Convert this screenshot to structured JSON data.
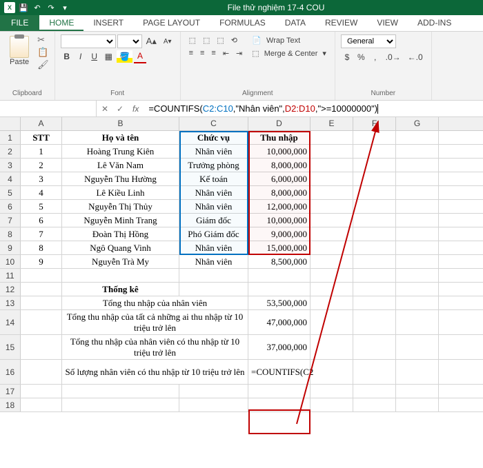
{
  "app": {
    "title": "File thử nghiệm 17-4 COU"
  },
  "tabs": {
    "file": "FILE",
    "home": "HOME",
    "insert": "INSERT",
    "page_layout": "PAGE LAYOUT",
    "formulas": "FORMULAS",
    "data": "DATA",
    "review": "REVIEW",
    "view": "VIEW",
    "addins": "ADD-INS"
  },
  "ribbon": {
    "clipboard": {
      "paste": "Paste",
      "label": "Clipboard"
    },
    "font": {
      "label": "Font",
      "size": "A",
      "grow": "A",
      "bold": "B",
      "italic": "I",
      "underline": "U"
    },
    "alignment": {
      "wrap": "Wrap Text",
      "merge": "Merge & Center",
      "label": "Alignment"
    },
    "number": {
      "select": "General",
      "label": "Number"
    }
  },
  "formula_bar": {
    "check": "✓",
    "cancel": "✕",
    "fx": "fx",
    "prefix": "=COUNTIFS(",
    "range1": "C2:C10",
    "text1": ",\"Nhân viên\",",
    "range2": "D2:D10",
    "text2": ",\">=10000000\")"
  },
  "headers": {
    "A": "A",
    "B": "B",
    "C": "C",
    "D": "D",
    "E": "E",
    "F": "F",
    "G": "G"
  },
  "table": {
    "h": {
      "stt": "STT",
      "name": "Họ và tên",
      "role": "Chức vụ",
      "income": "Thu nhập"
    },
    "rows": [
      {
        "stt": "1",
        "name": "Hoàng Trung Kiên",
        "role": "Nhân viên",
        "income": "10,000,000"
      },
      {
        "stt": "2",
        "name": "Lê Văn Nam",
        "role": "Trưởng phòng",
        "income": "8,000,000"
      },
      {
        "stt": "3",
        "name": "Nguyễn Thu Hường",
        "role": "Kế toán",
        "income": "6,000,000"
      },
      {
        "stt": "4",
        "name": "Lê Kiều Linh",
        "role": "Nhân viên",
        "income": "8,000,000"
      },
      {
        "stt": "5",
        "name": "Nguyễn Thị Thủy",
        "role": "Nhân viên",
        "income": "12,000,000"
      },
      {
        "stt": "6",
        "name": "Nguyễn Minh Trang",
        "role": "Giám đốc",
        "income": "10,000,000"
      },
      {
        "stt": "7",
        "name": "Đoàn Thị Hồng",
        "role": "Phó Giám đốc",
        "income": "9,000,000"
      },
      {
        "stt": "8",
        "name": "Ngô Quang Vinh",
        "role": "Nhân viên",
        "income": "15,000,000"
      },
      {
        "stt": "9",
        "name": "Nguyễn Trà My",
        "role": "Nhân viên",
        "income": "8,500,000"
      }
    ]
  },
  "stats": {
    "title": "Thống kê",
    "r13": {
      "label": "Tổng thu nhập của nhân viên",
      "val": "53,500,000"
    },
    "r14": {
      "label": "Tổng thu nhập của tất cả những ai thu nhập từ 10 triệu trở lên",
      "val": "47,000,000"
    },
    "r15": {
      "label": "Tổng thu nhập của nhân viên có thu nhập từ 10 triệu trở lên",
      "val": "37,000,000"
    },
    "r16": {
      "label": "Số lượng nhân viên có thu nhập từ 10 triệu trở lên",
      "val": "=COUNTIFS(C2"
    }
  }
}
